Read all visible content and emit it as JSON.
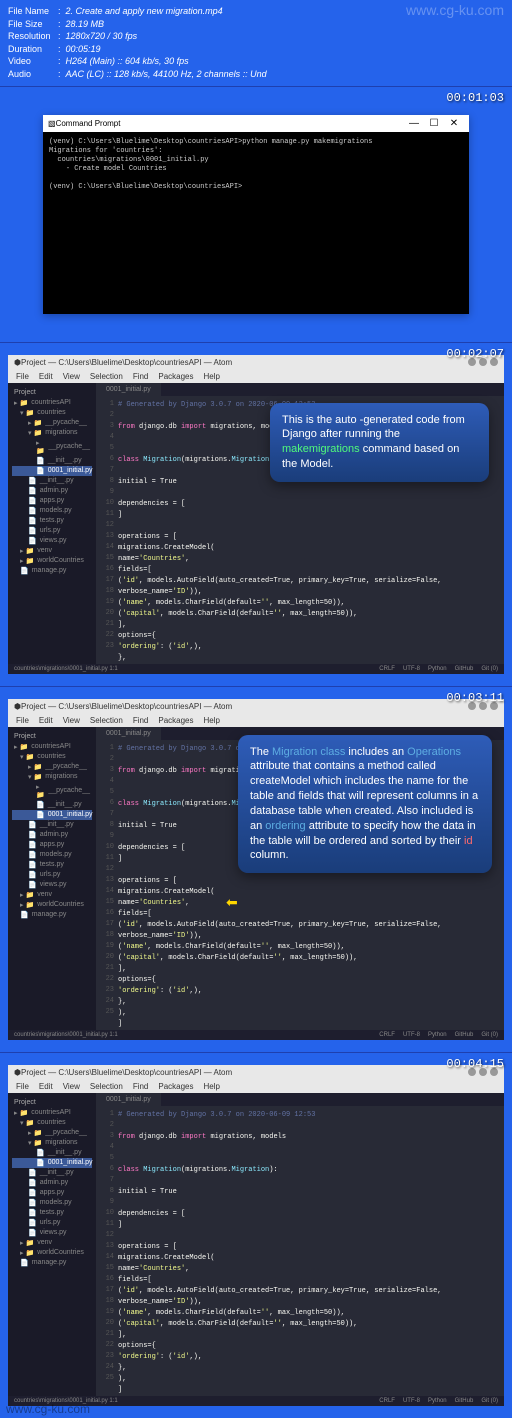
{
  "watermark": "www.cg-ku.com",
  "info": {
    "fileName": "2. Create and apply new migration.mp4",
    "fileSize": "28.19 MB",
    "resolution": "1280x720 / 30 fps",
    "duration": "00:05:19",
    "video": "H264 (Main) :: 604 kb/s, 30 fps",
    "audio": "AAC (LC) :: 128 kb/s, 44100 Hz, 2 channels :: Und"
  },
  "frames": [
    {
      "timestamp": "00:01:03"
    },
    {
      "timestamp": "00:02:07"
    },
    {
      "timestamp": "00:03:11"
    },
    {
      "timestamp": "00:04:15"
    }
  ],
  "cmdPrompt": {
    "title": "Command Prompt",
    "line1": "(venv) C:\\Users\\Bluelime\\Desktop\\countriesAPI>python manage.py makemigrations",
    "line2": "Migrations for 'countries':",
    "line3": "  countries\\migrations\\0001_initial.py",
    "line4": "    - Create model Countries",
    "line5": "",
    "line6": "(venv) C:\\Users\\Bluelime\\Desktop\\countriesAPI>"
  },
  "atom": {
    "title": "Project — C:\\Users\\Bluelime\\Desktop\\countriesAPI — Atom",
    "menu": [
      "File",
      "Edit",
      "View",
      "Selection",
      "Find",
      "Packages",
      "Help"
    ],
    "projectHeader": "Project",
    "tree": {
      "root": "countriesAPI",
      "countries": "countries",
      "pycache": "__pycache__",
      "migrations": "migrations",
      "pycache2": "__pycache__",
      "init": "__init__.py",
      "initial": "0001_initial.py",
      "init2": "__init__.py",
      "admin": "admin.py",
      "apps": "apps.py",
      "models": "models.py",
      "tests": "tests.py",
      "urls": "urls.py",
      "views": "views.py",
      "venv": "venv",
      "worldCountries": "worldCountries",
      "manage": "manage.py"
    },
    "tabName": "0001_initial.py",
    "code": {
      "l1": "# Generated by Django 3.0.7 on 2020-06-09 12:53",
      "l3a": "from",
      "l3b": " django.db ",
      "l3c": "import",
      "l3d": " migrations, models",
      "l6a": "class ",
      "l6b": "Migration",
      "l6c": "(migrations.",
      "l6d": "Migration",
      "l6e": "):",
      "l8": "    initial = True",
      "l10": "    dependencies = [",
      "l11": "    ]",
      "l13": "    operations = [",
      "l14": "        migrations.CreateModel(",
      "l15a": "            name=",
      "l15b": "'Countries'",
      "l15c": ",",
      "l16": "            fields=[",
      "l17a": "                (",
      "l17b": "'id'",
      "l17c": ", models.AutoField(auto_created=True, primary_key=True, serialize=False, verbose_name=",
      "l17d": "'ID'",
      "l17e": ")),",
      "l18a": "                (",
      "l18b": "'name'",
      "l18c": ", models.CharField(default=",
      "l18d": "''",
      "l18e": ", max_length=50)),",
      "l19a": "                (",
      "l19b": "'capital'",
      "l19c": ", models.CharField(default=",
      "l19d": "''",
      "l19e": ", max_length=50)),",
      "l20": "            ],",
      "l21": "            options={",
      "l22a": "                ",
      "l22b": "'ordering'",
      "l22c": ": (",
      "l22d": "'id'",
      "l22e": ",),",
      "l23": "            },",
      "l24": "        ),",
      "l25": "    ]"
    },
    "statusPath": "countries\\migrations\\0001_initial.py  1:1",
    "statusRight": {
      "crlf": "CRLF",
      "utf": "UTF-8",
      "python": "Python",
      "github": "GitHub",
      "git": "Git (0)"
    }
  },
  "callouts": {
    "c1p1": "This is the auto -generated code from Django after running the ",
    "c1cmd": "makemigrations",
    "c1p2": " command based on the Model.",
    "c2p1": "The ",
    "c2cls": "Migration class",
    "c2p2": " includes an ",
    "c2attr": "Operations",
    "c2p3": " attribute that contains a method called createModel which includes the name for the table and fields that will represent columns in a database table when created. Also included  is an ",
    "c2ord": "ordering",
    "c2p4": " attribute to specify how the data in the table will be ordered and sorted by their ",
    "c2id": "id",
    "c2p5": " column."
  }
}
